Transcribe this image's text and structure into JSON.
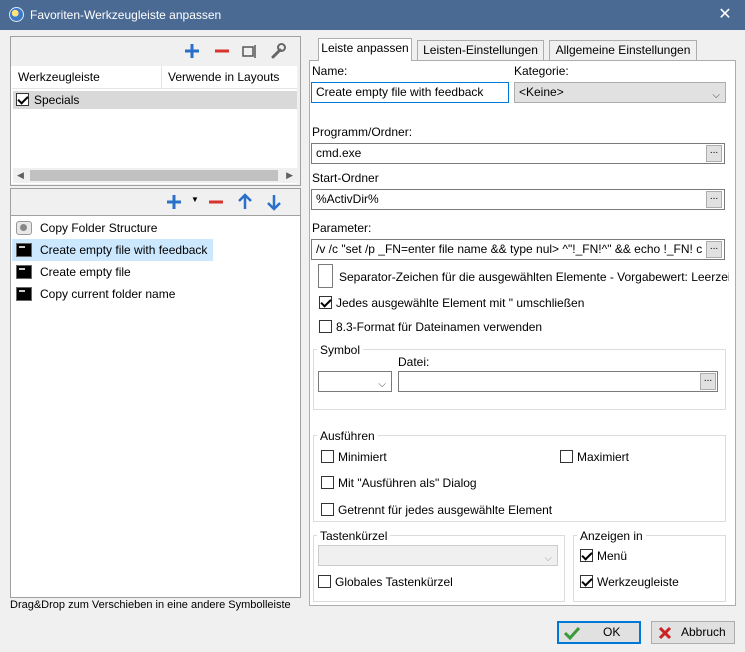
{
  "window": {
    "title": "Favoriten-Werkzeugleiste anpassen",
    "close_glyph": "✕"
  },
  "left": {
    "top_toolbar_icons": [
      "add-icon",
      "remove-icon",
      "layout-icon",
      "wrench-icon"
    ],
    "table": {
      "headers": [
        "Werkzeugleiste",
        "Verwende in Layouts"
      ],
      "rows": [
        {
          "name": "Specials",
          "checked": true
        }
      ]
    },
    "bottom_toolbar_icons": [
      "add-icon",
      "dropdown-icon",
      "remove-icon",
      "arrow-up-icon",
      "arrow-down-icon"
    ],
    "commands": [
      {
        "label": "Copy Folder Structure",
        "icon": "gear-icon"
      },
      {
        "label": "Create empty file with feedback",
        "icon": "console-icon",
        "selected": true
      },
      {
        "label": "Create empty file",
        "icon": "console-icon"
      },
      {
        "label": "Copy current folder name",
        "icon": "console-icon"
      }
    ],
    "hint": "Drag&Drop zum Verschieben in eine andere Symbolleiste"
  },
  "tabs": [
    "Leiste anpassen",
    "Leisten-Einstellungen",
    "Allgemeine Einstellungen"
  ],
  "form": {
    "name_label": "Name:",
    "name_value": "Create empty file with feedback",
    "category_label": "Kategorie:",
    "category_value": "<Keine>",
    "program_label": "Programm/Ordner:",
    "program_value": "cmd.exe",
    "start_label": "Start-Ordner",
    "start_value": "%ActivDir%",
    "param_label": "Parameter:",
    "param_value": "/v /c \"set /p _FN=enter file name && type nul> ^\"!_FN!^\" && echo !_FN! c",
    "separator_label": "Separator-Zeichen für die ausgewählten Elemente - Vorgabewert: Leerzeich",
    "quote_label": "Jedes ausgewählte Element mit \" umschließen",
    "quote_checked": true,
    "short_label": "8.3-Format für Dateinamen verwenden",
    "short_checked": false,
    "browse_glyph": "...",
    "symbol_group": "Symbol",
    "file_label": "Datei:",
    "execute_group": "Ausführen",
    "minimized": "Minimiert",
    "maximized": "Maximiert",
    "runas": "Mit \"Ausführen als\" Dialog",
    "separate": "Getrennt für jedes ausgewählte Element",
    "hotkey_group": "Tastenkürzel",
    "global_hotkey": "Globales Tastenkürzel",
    "show_group": "Anzeigen in",
    "show_menu": "Menü",
    "show_menu_checked": true,
    "show_toolbar": "Werkzeugleiste",
    "show_toolbar_checked": true
  },
  "buttons": {
    "ok": "OK",
    "cancel": "Abbruch"
  },
  "colors": {
    "accent": "#0078d7",
    "title_bar": "#4a6a94",
    "add": "#2a6fc9",
    "remove": "#d9332e",
    "ok_check": "#3a9a3a",
    "cancel_x": "#cc2222"
  }
}
